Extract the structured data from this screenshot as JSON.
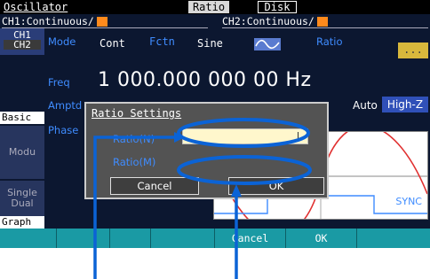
{
  "topbar": {
    "oscillator": "Oscillator",
    "ratio": "Ratio",
    "disk": "Disk"
  },
  "channels": {
    "ch1": "CH1:Continuous/",
    "ch2": "CH2:Continuous/"
  },
  "leftcol": {
    "ch1": "CH1",
    "ch2": "CH2",
    "basic": "Basic",
    "modu": "Modu",
    "single": "Single",
    "dual": "Dual",
    "graph": "Graph"
  },
  "params": {
    "mode": "Mode",
    "freq": "Freq",
    "amptd": "Amptd",
    "phase": "Phase"
  },
  "mode_row": {
    "cont": "Cont",
    "fctn": "Fctn",
    "sine": "Sine"
  },
  "ratio_label": "Ratio",
  "dots": "...",
  "freq_value": "1 000.000 000 00  Hz",
  "amptd": {
    "auto": "Auto",
    "highz": "High-Z"
  },
  "graph": {
    "sync": "SYNC"
  },
  "dialog": {
    "title": "Ratio Settings",
    "ratio_n_label": "Ratio(N)",
    "ratio_m_label": "Ratio(M)",
    "ratio_n_value": "",
    "cancel": "Cancel",
    "ok": "OK"
  },
  "softkeys": [
    "",
    "",
    "",
    "",
    "Cancel",
    "OK",
    ""
  ],
  "colors": {
    "accent_blue": "#3f8cff",
    "orange": "#ff8a1c",
    "teal": "#1a9aa4",
    "annotation": "#0b63d6"
  }
}
